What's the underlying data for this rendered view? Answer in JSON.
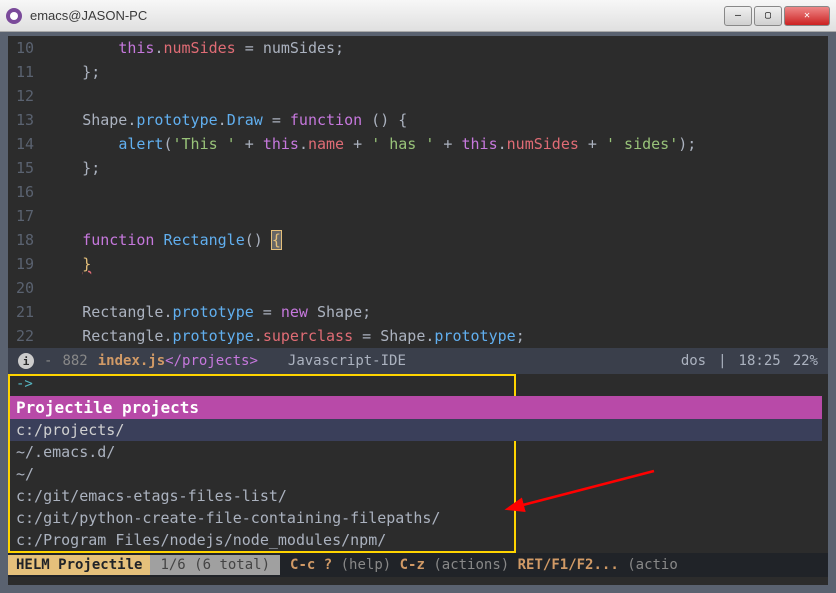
{
  "window": {
    "title": "emacs@JASON-PC"
  },
  "code": {
    "lines": [
      {
        "n": 10,
        "html": "        <span class='this'>this</span><span class='plain'>.</span><span class='prop'>numSides</span><span class='plain'> = </span><span class='plain'>numSides;</span>"
      },
      {
        "n": 11,
        "html": "    };"
      },
      {
        "n": 12,
        "html": ""
      },
      {
        "n": 13,
        "html": "    <span class='plain'>Shape.</span><span class='fn'>prototype</span><span class='plain'>.</span><span class='fn'>Draw</span><span class='plain'> = </span><span class='kw'>function</span><span class='plain'> () {</span>"
      },
      {
        "n": 14,
        "html": "        <span class='fn'>alert</span><span class='plain'>(</span><span class='str'>'This '</span><span class='plain'> + </span><span class='this'>this</span><span class='plain'>.</span><span class='prop'>name</span><span class='plain'> + </span><span class='str'>' has '</span><span class='plain'> + </span><span class='this'>this</span><span class='plain'>.</span><span class='prop'>numSides</span><span class='plain'> + </span><span class='str'>' sides'</span><span class='plain'>);</span>"
      },
      {
        "n": 15,
        "html": "    };"
      },
      {
        "n": 16,
        "html": ""
      },
      {
        "n": 17,
        "html": ""
      },
      {
        "n": 18,
        "html": "    <span class='kw'>function</span> <span class='fn'>Rectangle</span><span class='plain'>()</span> <span class='brace-hl'>{</span>"
      },
      {
        "n": 19,
        "html": "    <span class='warn-brace'>}</span>"
      },
      {
        "n": 20,
        "html": ""
      },
      {
        "n": 21,
        "html": "    <span class='plain'>Rectangle.</span><span class='fn'>prototype</span><span class='plain'> = </span><span class='kw'>new</span><span class='plain'> Shape;</span>"
      },
      {
        "n": 22,
        "html": "    <span class='plain'>Rectangle.</span><span class='fn'>prototype</span><span class='plain'>.</span><span class='prop'>superclass</span><span class='plain'> = Shape.</span><span class='fn'>prototype</span><span class='plain'>;</span>"
      }
    ]
  },
  "modeline": {
    "dash": "-",
    "size": "882",
    "buffer": "index.js",
    "project": "</projects>",
    "mode": "Javascript-IDE",
    "eol": "dos",
    "line": "18:25",
    "pct": "22%"
  },
  "helm": {
    "prompt": "->",
    "header": "Projectile projects",
    "items": [
      "c:/projects/",
      "~/.emacs.d/",
      "~/",
      "c:/git/emacs-etags-files-list/",
      "c:/git/python-create-file-containing-filepaths/",
      "c:/Program Files/nodejs/node_modules/npm/"
    ],
    "selectedIndex": 0,
    "ml_title": "HELM Projectile",
    "ml_count": "1/6 (6 total)",
    "ml_help_k1": "C-c ?",
    "ml_help_t1": " (help) ",
    "ml_help_k2": "C-z",
    "ml_help_t2": " (actions) ",
    "ml_help_k3": "RET/F1/F2...",
    "ml_help_t3": " (actio"
  }
}
